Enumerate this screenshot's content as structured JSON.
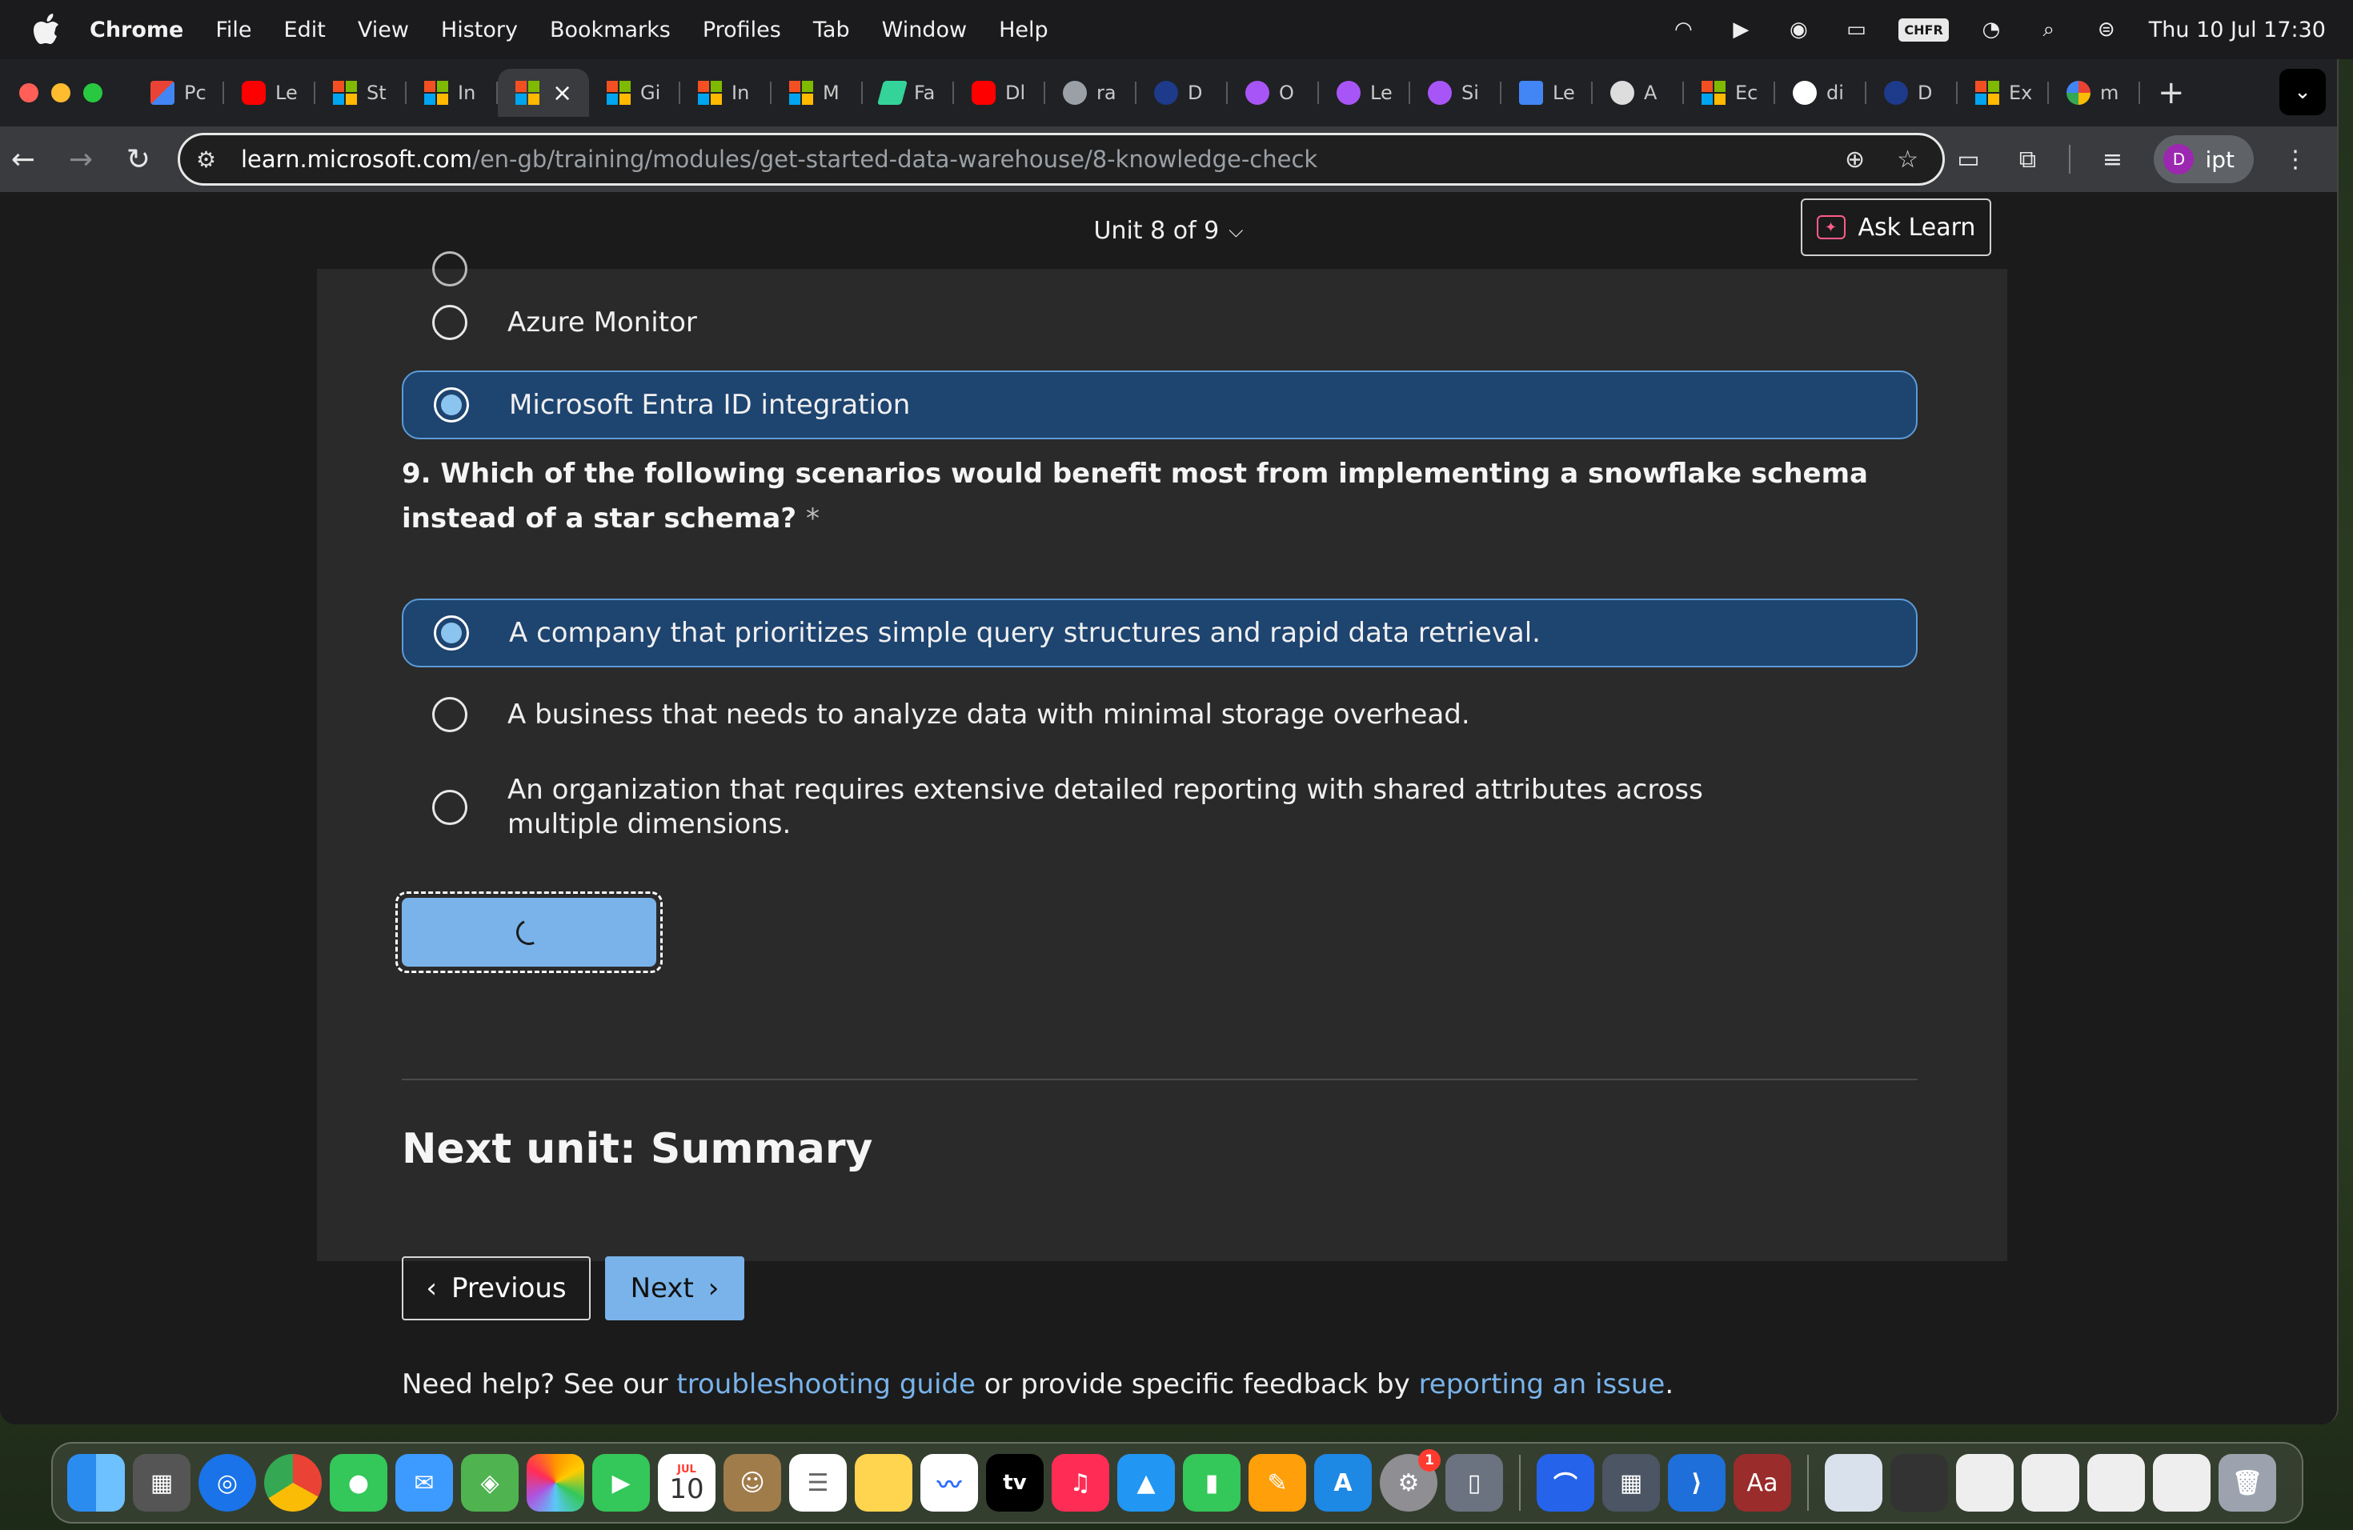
{
  "menubar": {
    "app_name": "Chrome",
    "items": [
      "File",
      "Edit",
      "View",
      "History",
      "Bookmarks",
      "Profiles",
      "Tab",
      "Window",
      "Help"
    ],
    "status_chip": "CHFR",
    "datetime": "Thu 10 Jul  17:30"
  },
  "tabs": [
    {
      "label": "Pc",
      "icon": "gmail-icon"
    },
    {
      "label": "Le",
      "icon": "youtube-icon"
    },
    {
      "label": "St",
      "icon": "microsoft-icon"
    },
    {
      "label": "In",
      "icon": "microsoft-icon"
    },
    {
      "label": "",
      "icon": "microsoft-icon",
      "active": true
    },
    {
      "label": "Gi",
      "icon": "microsoft-icon"
    },
    {
      "label": "In",
      "icon": "microsoft-icon"
    },
    {
      "label": "M",
      "icon": "microsoft-icon"
    },
    {
      "label": "Fa",
      "icon": "feather-icon"
    },
    {
      "label": "Dl",
      "icon": "youtube-icon"
    },
    {
      "label": "ra",
      "icon": "globe-icon"
    },
    {
      "label": "D",
      "icon": "powershell-icon"
    },
    {
      "label": "O",
      "icon": "clickup-icon"
    },
    {
      "label": "Le",
      "icon": "clickup-icon"
    },
    {
      "label": "Si",
      "icon": "clickup-icon"
    },
    {
      "label": "Le",
      "icon": "docs-icon"
    },
    {
      "label": "A",
      "icon": "openai-icon"
    },
    {
      "label": "Ec",
      "icon": "microsoft-icon"
    },
    {
      "label": "di",
      "icon": "github-icon"
    },
    {
      "label": "D",
      "icon": "powershell-icon"
    },
    {
      "label": "Ex",
      "icon": "microsoft-icon"
    },
    {
      "label": "m",
      "icon": "google-icon"
    }
  ],
  "address": {
    "host": "learn.microsoft.com",
    "path": "/en-gb/training/modules/get-started-data-warehouse/8-knowledge-check"
  },
  "profile": {
    "initial": "D",
    "name": "ipt"
  },
  "page": {
    "unit_label": "Unit 8 of 9",
    "ask_learn": "Ask Learn",
    "q8_options": [
      {
        "label": "Azure Monitor",
        "selected": false
      },
      {
        "label": "Microsoft Entra ID integration",
        "selected": true
      }
    ],
    "q9": {
      "text": "9. Which of the following scenarios would benefit most from implementing a snowflake schema instead of a star schema?",
      "required_mark": "*",
      "options": [
        {
          "label": "A company that prioritizes simple query structures and rapid data retrieval.",
          "selected": true
        },
        {
          "label": "A business that needs to analyze data with minimal storage overhead.",
          "selected": false
        },
        {
          "label": "An organization that requires extensive detailed reporting with shared attributes across multiple dimensions.",
          "selected": false
        }
      ]
    },
    "next_unit": "Next unit: Summary",
    "previous_label": "Previous",
    "next_label": "Next",
    "help": {
      "prefix": "Need help? See our ",
      "link1": "troubleshooting guide",
      "middle": " or provide specific feedback by ",
      "link2": "reporting an issue",
      "suffix": "."
    }
  },
  "dock": {
    "calendar_month": "JUL",
    "calendar_day": "10",
    "system_settings_badge": "1",
    "tv_label": "tv",
    "dictionary_label": "Aa"
  },
  "colors": {
    "selected_bg": "#1e4470",
    "accent": "#79b3ea",
    "page_bg": "#1b1b1b",
    "card_bg": "#2a2a2a"
  }
}
